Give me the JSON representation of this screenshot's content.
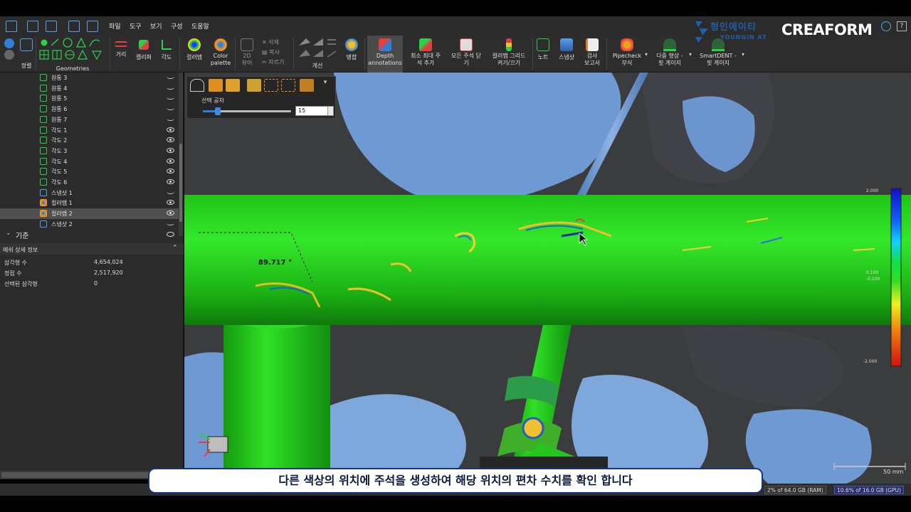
{
  "menubar": {
    "items": [
      "파일",
      "도구",
      "보기",
      "구성",
      "도움말"
    ]
  },
  "brand": {
    "korean": "형인에이티",
    "sub": "YOUNGIN AT",
    "creaform": "CREAFORM"
  },
  "ribbon": {
    "align": "정렬",
    "geometries": "Geometries",
    "distance": "거리",
    "caliper": "캘리퍼",
    "angle": "각도",
    "colormap": "컬러맵",
    "color_palette": "Color\npalette",
    "view2d": "2D\n뷰어",
    "delete": "삭제",
    "copy": "복사",
    "cut": "자르기",
    "improve": "개선",
    "merge": "병합",
    "depth_annotations": "Depth\nannotations",
    "min_max_add": "최소 최대 주\n석 추가",
    "close_all_annotations": "모든 주석 닫\n기",
    "colormap_grid": "컬러맵 그리드\n켜기/끄기",
    "note": "노트",
    "snapshot": "스냅샷",
    "inspection_report": "검사\n보고서",
    "pipecheck": "Pipecheck\n부식",
    "multi_shape": "다중 형상 -\n핏 게이지",
    "smartdent": "SmartDENT -\n핏 게이지"
  },
  "tree": {
    "items": [
      {
        "label": "원통 3",
        "icon": "cylinder-icon",
        "visible": false
      },
      {
        "label": "원통 4",
        "icon": "cylinder-icon",
        "visible": false
      },
      {
        "label": "원통 5",
        "icon": "cylinder-icon",
        "visible": false
      },
      {
        "label": "원통 6",
        "icon": "cylinder-icon",
        "visible": false
      },
      {
        "label": "원통 7",
        "icon": "cylinder-icon",
        "visible": false
      },
      {
        "label": "각도 1",
        "icon": "angle-icon",
        "visible": true
      },
      {
        "label": "각도 2",
        "icon": "angle-icon",
        "visible": true
      },
      {
        "label": "각도 3",
        "icon": "angle-icon",
        "visible": true
      },
      {
        "label": "각도 4",
        "icon": "angle-icon",
        "visible": true
      },
      {
        "label": "각도 5",
        "icon": "angle-icon",
        "visible": true
      },
      {
        "label": "각도 6",
        "icon": "angle-icon",
        "visible": true
      },
      {
        "label": "스냅샷 1",
        "icon": "snapshot-icon",
        "visible": false
      },
      {
        "label": "컬러맵 1",
        "icon": "colormap-icon",
        "visible": true
      },
      {
        "label": "컬러맵 2",
        "icon": "colormap-icon",
        "visible": true,
        "selected": true
      },
      {
        "label": "스냅샷 2",
        "icon": "snapshot-icon",
        "visible": false
      }
    ],
    "reference": "기준"
  },
  "mesh_details": {
    "title": "메쉬 상세 정보",
    "rows": [
      {
        "label": "삼각형 수",
        "value": "4,654,024"
      },
      {
        "label": "정점 수",
        "value": "2,517,920"
      },
      {
        "label": "선택된 삼각형",
        "value": "0"
      }
    ]
  },
  "floating_toolbar": {
    "tolerance_label": "선택 공차",
    "tolerance_value": "15",
    "slider_fraction": 0.17
  },
  "viewport": {
    "angle_annotation": "89.717 °",
    "scale_top": "2.000",
    "scale_mid_upper": "0.100",
    "scale_mid_lower": "-0.100",
    "scale_bottom": "-2.000",
    "scale_bar": "50 mm"
  },
  "status": {
    "ram": "2% of 64.0 GB (RAM)",
    "gpu": "10.6% of 16.0 GB (GPU)"
  },
  "subtitle": "다른 색상의 위치에 주석을 생성하여 해당 위치의 편차 수치를 확인 합니다",
  "colors": {
    "pipe_green": "#22d41a",
    "scan_blue": "#7ea8dc",
    "accent_blue": "#2f7fd8",
    "brand_navy": "#17338a"
  }
}
